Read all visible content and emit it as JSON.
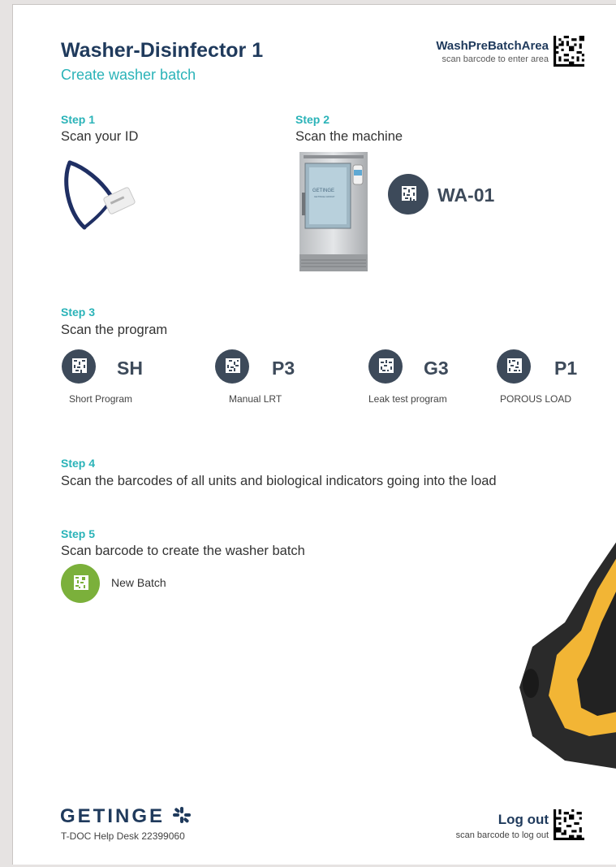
{
  "header": {
    "title": "Washer-Disinfector 1",
    "subtitle": "Create washer batch",
    "area_name": "WashPreBatchArea",
    "area_hint": "scan barcode to enter area"
  },
  "step1": {
    "label": "Step 1",
    "text": "Scan your ID"
  },
  "step2": {
    "label": "Step 2",
    "text": "Scan the machine",
    "machine_code": "WA-01",
    "machine_brand": "GETINGE",
    "machine_brand_sub": "GETINGE GROUP"
  },
  "step3": {
    "label": "Step 3",
    "text": "Scan the program",
    "programs": [
      {
        "code": "SH",
        "name": "Short Program"
      },
      {
        "code": "P3",
        "name": "Manual LRT"
      },
      {
        "code": "G3",
        "name": "Leak test program"
      },
      {
        "code": "P1",
        "name": "POROUS LOAD"
      }
    ]
  },
  "step4": {
    "label": "Step 4",
    "text": "Scan the barcodes of all units and biological indicators going into the load"
  },
  "step5": {
    "label": "Step 5",
    "text": "Scan barcode to create the washer batch",
    "action": "New Batch"
  },
  "footer": {
    "brand": "GETINGE",
    "helpdesk": "T-DOC Help Desk 22399060",
    "logout": "Log out",
    "logout_hint": "scan barcode to log out"
  },
  "colors": {
    "navy": "#1f3a5c",
    "teal": "#2ab3b8",
    "slate": "#3d4a5a",
    "green": "#7bb03b",
    "scanner_yellow": "#f2b535"
  }
}
